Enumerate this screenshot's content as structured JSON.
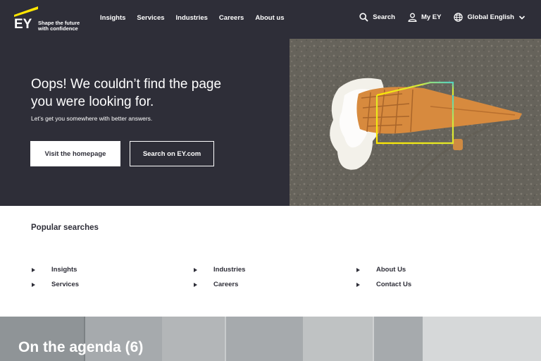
{
  "brand": {
    "name": "EY",
    "tagline_line1": "Shape the future",
    "tagline_line2": "with confidence",
    "accent_color": "#ffe600",
    "dark_color": "#2e2e38"
  },
  "nav": {
    "links": [
      "Insights",
      "Services",
      "Industries",
      "Careers",
      "About us"
    ],
    "search_label": "Search",
    "my_ey_label": "My EY",
    "locale_label": "Global English"
  },
  "hero": {
    "title_line1": "Oops! We couldn’t find the page",
    "title_line2": "you were looking for.",
    "subtitle": "Let’s get you somewhere with better answers.",
    "primary_button": "Visit the homepage",
    "secondary_button": "Search on EY.com",
    "image_alt": "dropped-ice-cream-cone"
  },
  "popular": {
    "title": "Popular searches",
    "items": [
      "Insights",
      "Services",
      "Industries",
      "Careers",
      "About Us",
      "Contact Us"
    ]
  },
  "agenda": {
    "title": "On the agenda (6)"
  }
}
